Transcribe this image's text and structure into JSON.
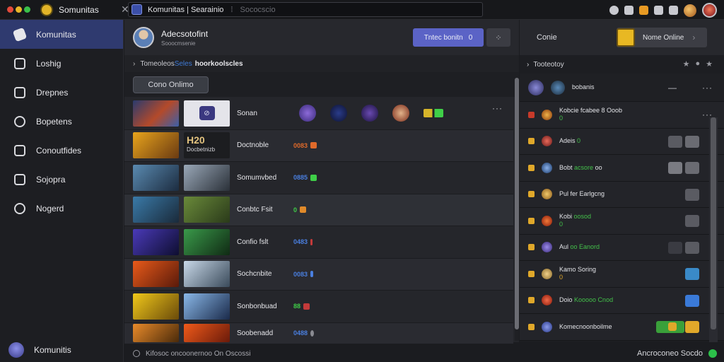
{
  "topbar": {
    "app_title": "Somunitas",
    "close_glyph": "✕",
    "search_text": "Komunitas | Searainio",
    "search_sep": "⁞",
    "search_placeholder": "Sococscio",
    "icons": [
      "moon-icon",
      "face-icon",
      "bookmark-icon",
      "grid-icon",
      "bell-icon",
      "user-avatar",
      "profile-avatar"
    ]
  },
  "sidebar": {
    "items": [
      {
        "label": "Komunitas",
        "icon": "check-icon",
        "active": true
      },
      {
        "label": "Loshig",
        "icon": "home-icon",
        "active": false
      },
      {
        "label": "Drepnes",
        "icon": "folder-icon",
        "active": false
      },
      {
        "label": "Bopetens",
        "icon": "circle-icon",
        "active": false
      },
      {
        "label": "Conoutfides",
        "icon": "window-icon",
        "active": false
      },
      {
        "label": "Sojopra",
        "icon": "edit-icon",
        "active": false
      },
      {
        "label": "Nogerd",
        "icon": "gear-icon",
        "active": false
      }
    ],
    "footer_label": "Komunitis"
  },
  "main": {
    "profile_name": "Adecsotofint",
    "profile_sub": "Sooocmsenie",
    "primary_button_label": "Tntec bonitn",
    "primary_button_count": "0",
    "icon_button_glyph": "⁘",
    "breadcrumb": {
      "chev": "›",
      "part1": "Tomeoleos",
      "part2": "Seles",
      "part3": "hoorkoolscles"
    },
    "tab_label": "Cono Onlimo",
    "rows": [
      {
        "name": "Sonan",
        "value": "",
        "kind": "avatars"
      },
      {
        "name": "Doctnoble",
        "value": "0083",
        "value_color": "#e06a2a",
        "badge_color": "#e06a2a",
        "thumb_title": "H20",
        "thumb_sub": "Docbetnizb"
      },
      {
        "name": "Somumvbed",
        "value": "0885",
        "value_color": "#4a7fe0",
        "badge_color": "#3fcf48"
      },
      {
        "name": "Conbtc Fsit",
        "value": "0",
        "value_color": "#3fcf48",
        "badge_color": "#e08a2a"
      },
      {
        "name": "Confio fslt",
        "value": "0483",
        "value_color": "#4a7fe0",
        "badge_color": "#c33a3a"
      },
      {
        "name": "Sochcnbite",
        "value": "0083",
        "value_color": "#4a7fe0",
        "badge_color": "#4a7fe0"
      },
      {
        "name": "Sonbonbuad",
        "value": "88",
        "value_color": "#3fcf48",
        "badge_color": "#c33a3a"
      },
      {
        "name": "Soobenadd",
        "value": "0488",
        "value_color": "#4a7fe0",
        "badge_color": "#8a8b92"
      }
    ],
    "row_more_glyph": "···"
  },
  "right_panel": {
    "title": "Conie",
    "online_label": "Nome Online",
    "online_chev": "›",
    "sub_chev": "›",
    "sub_label": "Tooteotoy",
    "first_row_label": "bobanis",
    "more_glyph": "···",
    "rows": [
      {
        "text": "Kobcie fcabee  8 Ooob",
        "green": "",
        "sub": "0",
        "check": "red",
        "btn": "dots"
      },
      {
        "text": "Adeis",
        "green": "0",
        "sub": "",
        "check": "amber",
        "btn": "gray2"
      },
      {
        "text": "Bobt",
        "green": "acsore",
        "tail": "oo",
        "check": "amber",
        "btn": "gray2"
      },
      {
        "text": "Pul fer Earlgcng",
        "green": "",
        "check": "amber",
        "btn": "gray1"
      },
      {
        "text": "Kobi",
        "green": "oosod",
        "sub": "0",
        "check": "amber",
        "btn": "gray1"
      },
      {
        "text": "Aul",
        "green": "oo Eanord",
        "check": "amber",
        "btn": "gray1"
      },
      {
        "text": "Kamo Soring",
        "green": "",
        "sub": "0",
        "check": "amber",
        "btn": "blue1"
      },
      {
        "text": "Doio",
        "green": "Kooooo Cnod",
        "check": "amber",
        "btn": "blue1"
      },
      {
        "text": "Komecnoonboilme",
        "green": "",
        "check": "amber",
        "btn": "greenorange"
      }
    ]
  },
  "status": {
    "left": "Kifosoc oncoonernoo  On Oscossi",
    "right": "Ancroconeo Socdo"
  },
  "colors": {
    "accent": "#5b63c6",
    "active_nav": "#2f3a6f",
    "online_green": "#2cc04a",
    "warning_amber": "#e0a82a"
  }
}
